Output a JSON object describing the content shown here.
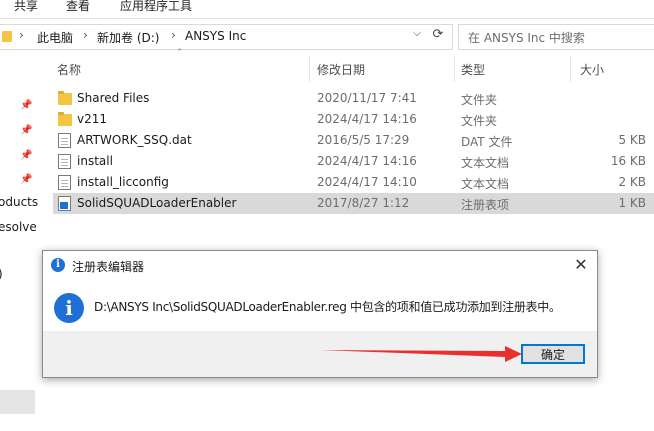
{
  "ribbon": {
    "tabs": [
      "共享",
      "查看",
      "应用程序工具"
    ]
  },
  "address": {
    "crumbs": [
      "此电脑",
      "新加卷 (D:)",
      "ANSYS Inc"
    ],
    "separator": "›"
  },
  "search": {
    "placeholder": "在 ANSYS Inc 中搜索"
  },
  "nav": {
    "items": [
      "oducts",
      "esolve",
      ")"
    ]
  },
  "columns": {
    "name": "名称",
    "date": "修改日期",
    "type": "类型",
    "size": "大小"
  },
  "files": [
    {
      "name": "Shared Files",
      "date": "2020/11/17 7:41",
      "type": "文件夹",
      "size": "",
      "icon": "folder-icon"
    },
    {
      "name": "v211",
      "date": "2024/4/17 14:16",
      "type": "文件夹",
      "size": "",
      "icon": "folder-icon"
    },
    {
      "name": "ARTWORK_SSQ.dat",
      "date": "2016/5/5 17:29",
      "type": "DAT 文件",
      "size": "5 KB",
      "icon": "file-icon"
    },
    {
      "name": "install",
      "date": "2024/4/17 14:16",
      "type": "文本文档",
      "size": "16 KB",
      "icon": "text-file-icon"
    },
    {
      "name": "install_licconfig",
      "date": "2024/4/17 14:10",
      "type": "文本文档",
      "size": "2 KB",
      "icon": "text-file-icon"
    },
    {
      "name": "SolidSQUADLoaderEnabler",
      "date": "2017/8/27 1:12",
      "type": "注册表项",
      "size": "1 KB",
      "icon": "registry-file-icon"
    }
  ],
  "dialog": {
    "title": "注册表编辑器",
    "close": "✕",
    "message": "D:\\ANSYS Inc\\SolidSQUADLoaderEnabler.reg 中包含的项和值已成功添加到注册表中。",
    "ok_label": "确定"
  },
  "colors": {
    "accent": "#0078d7",
    "info": "#1e6fd6",
    "annotation_arrow": "#e8312f",
    "folder": "#f3c542"
  }
}
